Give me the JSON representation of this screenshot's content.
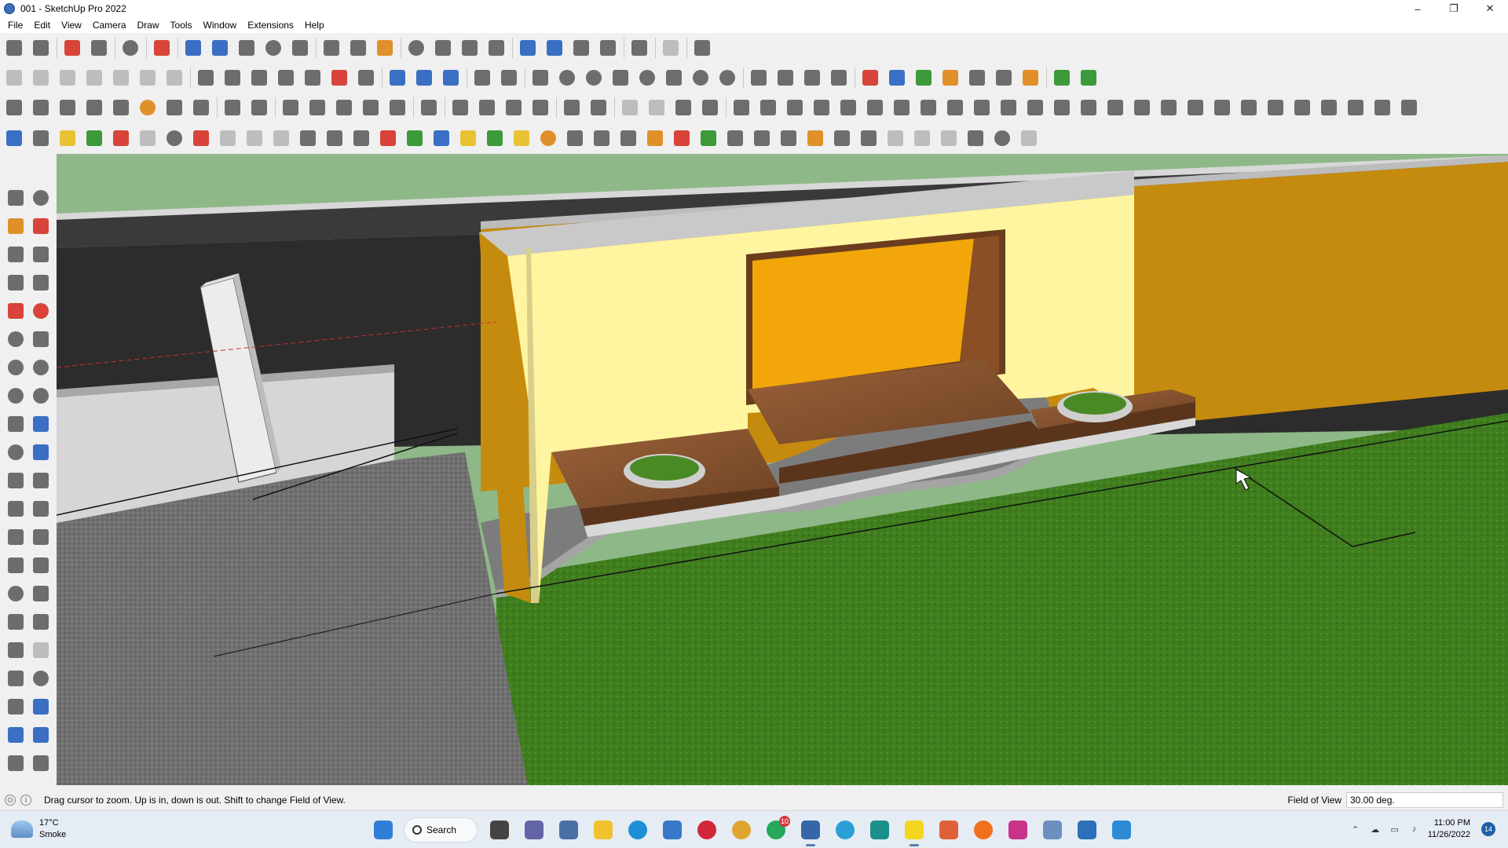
{
  "window": {
    "title": "001 - SketchUp Pro 2022",
    "minimize": "–",
    "maximize": "❐",
    "close": "✕"
  },
  "menu": [
    "File",
    "Edit",
    "View",
    "Camera",
    "Draw",
    "Tools",
    "Window",
    "Extensions",
    "Help"
  ],
  "toolbar_rows": [
    [
      "zoom-window-icon",
      "select-icon",
      "|",
      "eraser-icon",
      "line-icon",
      "|",
      "arc-icon",
      "|",
      "rectangle-icon",
      "|",
      "push-pull-icon",
      "follow-me-icon",
      "move-icon",
      "rotate-icon",
      "scale-icon",
      "|",
      "tape-measure-icon",
      "text-icon",
      "paint-bucket-icon",
      "|",
      "orbit-icon",
      "pan-icon",
      "zoom-icon",
      "zoom-extents-icon",
      "|",
      "warehouse-icon",
      "extension-warehouse-icon",
      "layout-icon",
      "extension-manager-icon",
      "|",
      "profile-icon",
      "|",
      "sandbox-icon",
      "|",
      "dynamic-components-icon"
    ],
    [
      "house-icon",
      "iso-view-icon",
      "top-view-icon",
      "front-view-icon",
      "right-view-icon",
      "back-view-icon",
      "left-view-icon",
      "|",
      "xray-icon",
      "back-edges-icon",
      "wireframe-icon",
      "hidden-line-icon",
      "shaded-icon",
      "textured-icon",
      "monochrome-icon",
      "|",
      "section-plane-icon",
      "display-section-icon",
      "section-cuts-icon",
      "|",
      "dimension-icon",
      "protractor-icon",
      "|",
      "offset-icon",
      "circle-icon",
      "polygon-icon",
      "ellipse-icon",
      "pie-icon",
      "freehand-icon",
      "2pt-arc-icon",
      "3pt-arc-icon",
      "|",
      "intersect-icon",
      "outer-shell-icon",
      "solid-union-icon",
      "solid-subtract-icon",
      "|",
      "axes-red-icon",
      "axes-blue-icon",
      "axes-green-icon",
      "axes-orange-icon",
      "axes-north-icon",
      "axes-x-icon",
      "axes-f-icon",
      "|",
      "stamp-icon",
      "drape-icon"
    ],
    [
      "component-icon",
      "group-icon",
      "model-info-icon",
      "guide-icon",
      "axes-tool-icon",
      "sun-icon",
      "shadow-icon",
      "fog-icon",
      "|",
      "outliner-icon",
      "materials-icon",
      "|",
      "styles-icon",
      "scenes-icon",
      "layers-icon",
      "entity-info-icon",
      "soften-icon",
      "|",
      "camera-position-icon",
      "|",
      "walk-icon",
      "look-around-icon",
      "position-camera-icon",
      "turntable-icon",
      "|",
      "previous-icon",
      "next-icon",
      "|",
      "standard-views-icon",
      "print-icon",
      "export-icon",
      "import-icon",
      "|",
      "flip-icon",
      "curve-icon",
      "weld-icon",
      "split-icon",
      "joint-icon",
      "fillet-icon",
      "chamfer-icon",
      "bezier-icon",
      "polyline-icon",
      "spline-icon",
      "loft-icon",
      "extrude-icon",
      "sweep-icon",
      "mirror-icon",
      "array-icon",
      "stair-icon",
      "railing-icon",
      "roof-icon",
      "beam-icon",
      "column-icon",
      "wall-icon",
      "slab-icon",
      "opening-icon",
      "window-tool-icon",
      "door-icon",
      "trim-icon"
    ],
    [
      "face-blue-icon",
      "face-cyan-icon",
      "face-yellow-icon",
      "face-green-icon",
      "face-red-icon",
      "face-white-icon",
      "rotate-face-icon",
      "red-square-icon",
      "grid-icon",
      "page-icon",
      "box-icon",
      "pipe-icon",
      "curve-path-icon",
      "polyline-path-icon",
      "add-red-icon",
      "add-green-icon",
      "cross-blue-icon",
      "cone-icon",
      "tree-icon",
      "warning-icon",
      "loop-icon",
      "chain-icon",
      "link-icon",
      "move-vertex-icon",
      "bucket-icon",
      "undo-red-icon",
      "plant-icon",
      "transform-icon",
      "multi-copy-icon",
      "scale-copy-icon",
      "tag-icon",
      "gear-cluster-icon",
      "panel-icon",
      "tile-icon",
      "tile-grid-icon",
      "tile-dots-icon",
      "x-points-icon",
      "dotted-arc-icon",
      "grid-box-icon"
    ]
  ],
  "palette": [
    "select-icon",
    "orbit-icon",
    "paint-bucket-icon",
    "eraser-icon",
    "make-component-icon",
    "tape-icon",
    "line-icon",
    "freehand-icon",
    "rectangle-icon",
    "rotated-rectangle-icon",
    "circle-icon",
    "polygon-icon",
    "arc-icon",
    "2pt-arc-icon",
    "3pt-arc-icon",
    "pie-icon",
    "move-icon",
    "push-pull-icon",
    "rotate-icon",
    "follow-me-icon",
    "scale-icon",
    "offset-icon",
    "tape-measure-icon",
    "dimension-icon",
    "protractor-icon",
    "text-icon",
    "axes-icon",
    "3d-text-icon",
    "orbit-tool-icon",
    "pan-tool-icon",
    "zoom-tool-icon",
    "zoom-window-tool-icon",
    "zoom-extents-tool-icon",
    "previous-view-icon",
    "position-camera-tool-icon",
    "look-around-tool-icon",
    "walk-tool-icon",
    "section-plane-tool-icon",
    "warehouse-tool-icon",
    "extension-warehouse-tool-icon",
    "layout-tool-icon",
    "extension-manager-tool-icon"
  ],
  "status": {
    "hint": "Drag cursor to zoom.  Up is in, down is out. Shift to change Field of View.",
    "fov_label": "Field of View",
    "fov_value": "30.00 deg."
  },
  "taskbar": {
    "temperature": "17°C",
    "weather": "Smoke",
    "search": "Search",
    "whatsapp_badge": "10",
    "time": "11:00 PM",
    "date": "11/26/2022",
    "notifications": "14",
    "apps": [
      "windows-start-icon",
      "search-box",
      "task-view-icon",
      "teams-chat-icon",
      "calculator-icon",
      "file-explorer-icon",
      "edge-icon",
      "store-icon",
      "opera-icon",
      "chrome-icon",
      "whatsapp-icon",
      "sketchup-icon",
      "telegram-icon",
      "enscape-icon",
      "sticky-notes-icon",
      "grammarly-icon",
      "soundcloud-icon",
      "instagram-icon",
      "photos-icon",
      "snipping-icon",
      "paint-3d-icon"
    ]
  },
  "colors": {
    "sky": "#8fb888",
    "wall_dark": "#2e2e2e",
    "wall_orange": "#c58b0e",
    "feature_wall": "#fff5a0",
    "opening": "#f2a60a",
    "wood": "#8a5633",
    "grass": "#3d7a1e",
    "gravel": "#6e6e6e",
    "concrete": "#cfcfcf"
  }
}
